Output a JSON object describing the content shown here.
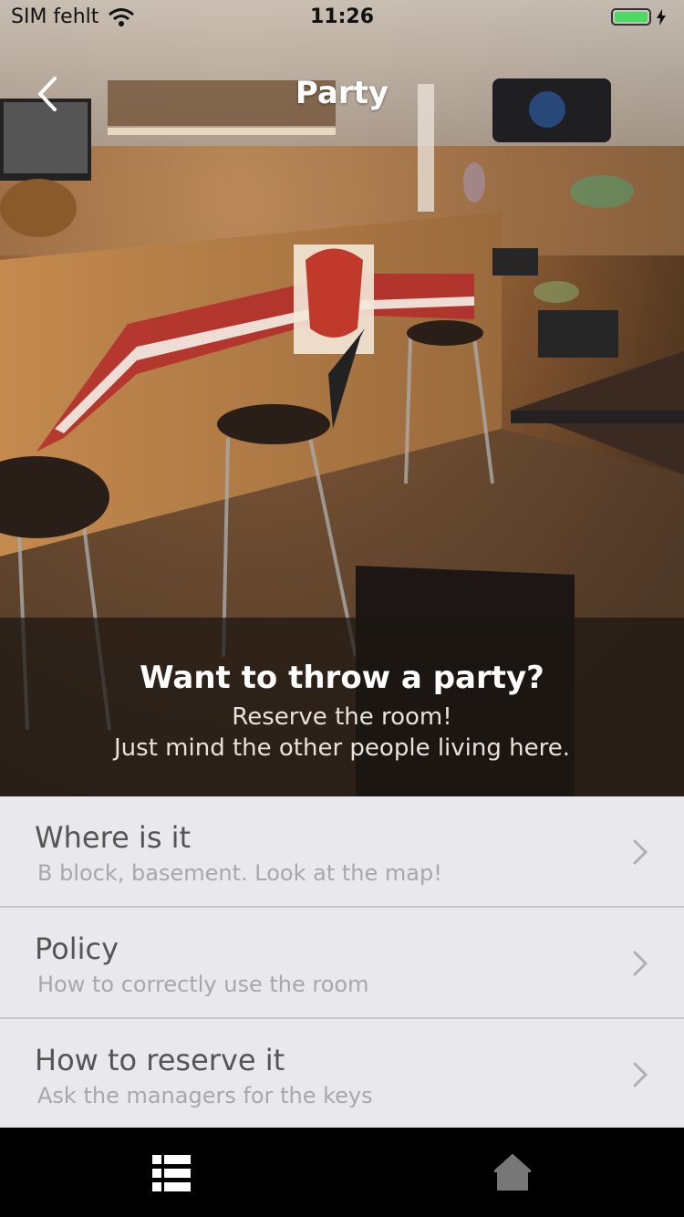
{
  "status_bar": {
    "carrier": "SIM fehlt",
    "time": "11:26",
    "battery_color": "#4cd964"
  },
  "nav": {
    "title": "Party"
  },
  "hero": {
    "title": "Want to throw a party?",
    "line1": "Reserve the room!",
    "line2": "Just mind the other people living here.",
    "icon": "bar-room-photo"
  },
  "items": [
    {
      "title": "Where is it",
      "subtitle": "B block, basement. Look at the map!"
    },
    {
      "title": "Policy",
      "subtitle": "How to correctly use the room"
    },
    {
      "title": "How to reserve it",
      "subtitle": "Ask the managers for the keys"
    }
  ],
  "tabbar": {
    "list_icon": "list-icon",
    "home_icon": "home-icon",
    "active_color": "#ffffff",
    "inactive_color": "#777777"
  }
}
